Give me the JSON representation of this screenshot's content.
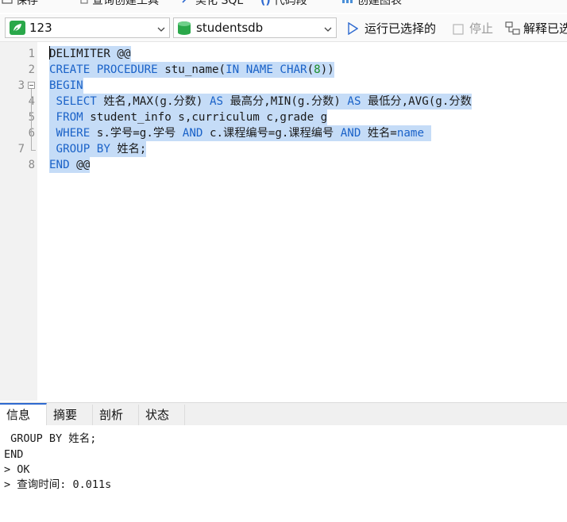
{
  "top_toolbar": {
    "save_label": "保存",
    "query_builder_label": "查询创建工具",
    "beautify_label": "美化 SQL",
    "snippet_label": "代码段",
    "create_chart_label": "创建图表"
  },
  "toolbar": {
    "connection": "123",
    "database": "studentsdb",
    "run_selected_label": "运行已选择的",
    "stop_label": "停止",
    "explain_label": "解释已选"
  },
  "editor": {
    "line_numbers": [
      "1",
      "2",
      "3",
      "4",
      "5",
      "6",
      "7",
      "8"
    ],
    "lines": [
      [
        {
          "t": "DELIMITER @@",
          "c": "id"
        }
      ],
      [
        {
          "t": "CREATE PROCEDURE ",
          "c": "kw"
        },
        {
          "t": "stu_name(",
          "c": "id"
        },
        {
          "t": "IN NAME CHAR",
          "c": "kw"
        },
        {
          "t": "(",
          "c": "id"
        },
        {
          "t": "8",
          "c": "num"
        },
        {
          "t": "))",
          "c": "id"
        }
      ],
      [
        {
          "t": "BEGIN",
          "c": "kw"
        }
      ],
      [
        {
          "t": " SELECT ",
          "c": "kw"
        },
        {
          "t": "姓名,MAX(g.分数) ",
          "c": "id"
        },
        {
          "t": "AS ",
          "c": "kw"
        },
        {
          "t": "最高分,MIN(g.分数) ",
          "c": "id"
        },
        {
          "t": "AS ",
          "c": "kw"
        },
        {
          "t": "最低分,AVG(g.分数",
          "c": "id"
        }
      ],
      [
        {
          "t": " FROM ",
          "c": "kw"
        },
        {
          "t": "student_info s,curriculum c,grade g",
          "c": "id"
        }
      ],
      [
        {
          "t": " WHERE ",
          "c": "kw"
        },
        {
          "t": "s.学号=g.学号 ",
          "c": "id"
        },
        {
          "t": "AND ",
          "c": "kw"
        },
        {
          "t": "c.课程编号=g.课程编号 ",
          "c": "id"
        },
        {
          "t": "AND ",
          "c": "kw"
        },
        {
          "t": "姓名=",
          "c": "id"
        },
        {
          "t": "name ",
          "c": "kw"
        }
      ],
      [
        {
          "t": " GROUP BY ",
          "c": "kw"
        },
        {
          "t": "姓名;",
          "c": "id"
        }
      ],
      [
        {
          "t": "END ",
          "c": "kw"
        },
        {
          "t": "@@",
          "c": "id"
        }
      ]
    ]
  },
  "tabs": [
    {
      "label": "信息",
      "active": true
    },
    {
      "label": "摘要",
      "active": false
    },
    {
      "label": "剖析",
      "active": false
    },
    {
      "label": "状态",
      "active": false
    }
  ],
  "output": {
    "lines": [
      " GROUP BY 姓名;",
      "END",
      "> OK",
      "> 查询时间: 0.011s"
    ]
  },
  "colors": {
    "keyword": "#1a62c8",
    "number": "#1b8f2a",
    "selection": "#c5dcf7",
    "db_icon": "#2aa84a"
  },
  "icons": {
    "connection": "leaf-connection-icon",
    "database": "database-icon",
    "run": "play-icon",
    "stop": "stop-icon",
    "explain": "explain-icon"
  }
}
